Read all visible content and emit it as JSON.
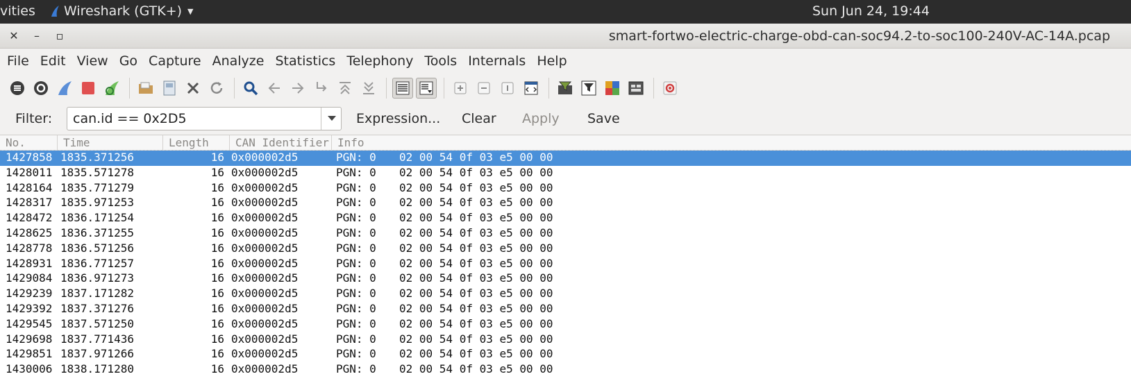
{
  "system_bar": {
    "activities": "vities",
    "app_name": "Wireshark (GTK+)",
    "clock": "Sun Jun 24, 19:44"
  },
  "window": {
    "close_glyph": "✕",
    "minimize_glyph": "–",
    "maximize_glyph": "▫",
    "title": "smart-fortwo-electric-charge-obd-can-soc94.2-to-soc100-240V-AC-14A.pcap"
  },
  "menu": [
    "File",
    "Edit",
    "View",
    "Go",
    "Capture",
    "Analyze",
    "Statistics",
    "Telephony",
    "Tools",
    "Internals",
    "Help"
  ],
  "toolbar": {
    "icons": [
      "interfaces-icon",
      "options-icon",
      "start-capture-icon",
      "stop-capture-icon",
      "restart-capture-icon",
      "open-file-icon",
      "save-file-icon",
      "close-file-icon",
      "reload-icon",
      "find-packet-icon",
      "go-back-icon",
      "go-forward-icon",
      "go-to-packet-icon",
      "first-packet-icon",
      "last-packet-icon",
      "colorize-icon",
      "autoscroll-icon",
      "zoom-in-icon",
      "zoom-out-icon",
      "normal-size-icon",
      "resize-columns-icon",
      "capture-filters-icon",
      "display-filters-icon",
      "coloring-rules-icon",
      "preferences-icon",
      "help-icon"
    ]
  },
  "filter": {
    "label": "Filter:",
    "value": "can.id == 0x2D5",
    "expression_label": "Expression...",
    "clear_label": "Clear",
    "apply_label": "Apply",
    "save_label": "Save"
  },
  "packet_list": {
    "columns": [
      "No.",
      "Time",
      "Length",
      "CAN Identifier",
      "Info"
    ],
    "selected_index": 0,
    "rows": [
      {
        "no": "1427858",
        "time": "1835.371256",
        "length": "16",
        "can_id": "0x000002d5",
        "pgn": "PGN: 0",
        "data": "02 00 54 0f 03 e5 00 00"
      },
      {
        "no": "1428011",
        "time": "1835.571278",
        "length": "16",
        "can_id": "0x000002d5",
        "pgn": "PGN: 0",
        "data": "02 00 54 0f 03 e5 00 00"
      },
      {
        "no": "1428164",
        "time": "1835.771279",
        "length": "16",
        "can_id": "0x000002d5",
        "pgn": "PGN: 0",
        "data": "02 00 54 0f 03 e5 00 00"
      },
      {
        "no": "1428317",
        "time": "1835.971253",
        "length": "16",
        "can_id": "0x000002d5",
        "pgn": "PGN: 0",
        "data": "02 00 54 0f 03 e5 00 00"
      },
      {
        "no": "1428472",
        "time": "1836.171254",
        "length": "16",
        "can_id": "0x000002d5",
        "pgn": "PGN: 0",
        "data": "02 00 54 0f 03 e5 00 00"
      },
      {
        "no": "1428625",
        "time": "1836.371255",
        "length": "16",
        "can_id": "0x000002d5",
        "pgn": "PGN: 0",
        "data": "02 00 54 0f 03 e5 00 00"
      },
      {
        "no": "1428778",
        "time": "1836.571256",
        "length": "16",
        "can_id": "0x000002d5",
        "pgn": "PGN: 0",
        "data": "02 00 54 0f 03 e5 00 00"
      },
      {
        "no": "1428931",
        "time": "1836.771257",
        "length": "16",
        "can_id": "0x000002d5",
        "pgn": "PGN: 0",
        "data": "02 00 54 0f 03 e5 00 00"
      },
      {
        "no": "1429084",
        "time": "1836.971273",
        "length": "16",
        "can_id": "0x000002d5",
        "pgn": "PGN: 0",
        "data": "02 00 54 0f 03 e5 00 00"
      },
      {
        "no": "1429239",
        "time": "1837.171282",
        "length": "16",
        "can_id": "0x000002d5",
        "pgn": "PGN: 0",
        "data": "02 00 54 0f 03 e5 00 00"
      },
      {
        "no": "1429392",
        "time": "1837.371276",
        "length": "16",
        "can_id": "0x000002d5",
        "pgn": "PGN: 0",
        "data": "02 00 54 0f 03 e5 00 00"
      },
      {
        "no": "1429545",
        "time": "1837.571250",
        "length": "16",
        "can_id": "0x000002d5",
        "pgn": "PGN: 0",
        "data": "02 00 54 0f 03 e5 00 00"
      },
      {
        "no": "1429698",
        "time": "1837.771436",
        "length": "16",
        "can_id": "0x000002d5",
        "pgn": "PGN: 0",
        "data": "02 00 54 0f 03 e5 00 00"
      },
      {
        "no": "1429851",
        "time": "1837.971266",
        "length": "16",
        "can_id": "0x000002d5",
        "pgn": "PGN: 0",
        "data": "02 00 54 0f 03 e5 00 00"
      },
      {
        "no": "1430006",
        "time": "1838.171280",
        "length": "16",
        "can_id": "0x000002d5",
        "pgn": "PGN: 0",
        "data": "02 00 54 0f 03 e5 00 00"
      }
    ]
  },
  "colors": {
    "selection": "#4a90d9",
    "top_bar": "#2c2c2c",
    "shark_fin": "#3a7bd5",
    "stop_red": "#e05050"
  }
}
